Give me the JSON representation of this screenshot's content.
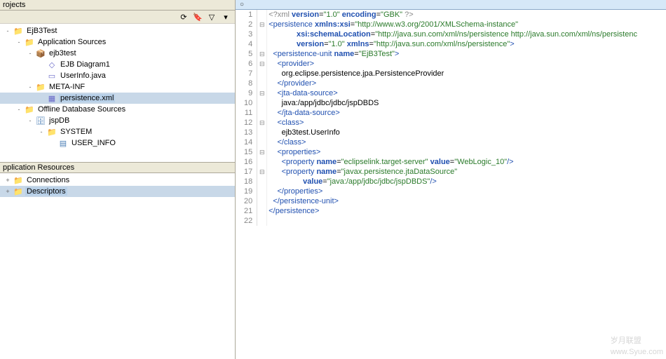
{
  "panels": {
    "projects_title": "rojects",
    "app_resources_title": "pplication Resources"
  },
  "toolbar_icons": [
    "refresh",
    "funnel",
    "layout",
    "menu"
  ],
  "tree": [
    {
      "d": 0,
      "tw": "-",
      "ico": "📁",
      "cls": "fold",
      "label": "EjB3Test",
      "int": true
    },
    {
      "d": 1,
      "tw": "-",
      "ico": "📁",
      "cls": "fold",
      "label": "Application Sources",
      "int": true
    },
    {
      "d": 2,
      "tw": "-",
      "ico": "📦",
      "cls": "pkg",
      "label": "ejb3test",
      "int": true
    },
    {
      "d": 3,
      "tw": " ",
      "ico": "◇",
      "cls": "file",
      "label": "EJB Diagram1",
      "int": true
    },
    {
      "d": 3,
      "tw": " ",
      "ico": "▭",
      "cls": "file",
      "label": "UserInfo.java",
      "int": true
    },
    {
      "d": 2,
      "tw": "-",
      "ico": "📁",
      "cls": "fold",
      "label": "META-INF",
      "int": true
    },
    {
      "d": 3,
      "tw": " ",
      "ico": "▦",
      "cls": "file",
      "label": "persistence.xml",
      "int": true,
      "sel": true
    },
    {
      "d": 1,
      "tw": "-",
      "ico": "📁",
      "cls": "fold",
      "label": "Offline Database Sources",
      "int": true
    },
    {
      "d": 2,
      "tw": "-",
      "ico": "🗄",
      "cls": "db",
      "label": "jspDB",
      "int": true
    },
    {
      "d": 3,
      "tw": "-",
      "ico": "📁",
      "cls": "fold",
      "label": "SYSTEM",
      "int": true
    },
    {
      "d": 4,
      "tw": " ",
      "ico": "▤",
      "cls": "db",
      "label": "USER_INFO",
      "int": true
    }
  ],
  "app_resources": [
    {
      "d": 0,
      "tw": "+",
      "ico": "📁",
      "cls": "fold",
      "label": "Connections",
      "int": true
    },
    {
      "d": 0,
      "tw": "+",
      "ico": "📁",
      "cls": "fold",
      "label": "Descriptors",
      "int": true,
      "sel": true
    }
  ],
  "editor_tab_marker": "○",
  "code_lines": [
    {
      "n": 1,
      "f": " ",
      "h": "<span class='t-gray'>&lt;?xml</span> <span class='t-attr'>version</span>=<span class='t-str'>\"1.0\"</span> <span class='t-attr'>encoding</span>=<span class='t-str'>\"GBK\"</span> <span class='t-gray'>?&gt;</span>"
    },
    {
      "n": 2,
      "f": "⊟",
      "h": "<span class='t-tag'>&lt;persistence</span> <span class='t-attr'>xmlns:xsi</span>=<span class='t-str'>\"http://www.w3.org/2001/XMLSchema-instance\"</span>"
    },
    {
      "n": 3,
      "f": " ",
      "h": "             <span class='t-attr'>xsi:schemaLocation</span>=<span class='t-str'>\"http://java.sun.com/xml/ns/persistence http://java.sun.com/xml/ns/persistenc</span>"
    },
    {
      "n": 4,
      "f": " ",
      "h": "             <span class='t-attr'>version</span>=<span class='t-str'>\"1.0\"</span> <span class='t-attr'>xmlns</span>=<span class='t-str'>\"http://java.sun.com/xml/ns/persistence\"</span><span class='t-tag'>&gt;</span>"
    },
    {
      "n": 5,
      "f": "⊟",
      "h": "  <span class='t-tag'>&lt;persistence-unit</span> <span class='t-attr'>name</span>=<span class='t-str'>\"EjB3Test\"</span><span class='t-tag'>&gt;</span>"
    },
    {
      "n": 6,
      "f": "⊟",
      "h": "    <span class='t-tag'>&lt;provider&gt;</span>"
    },
    {
      "n": 7,
      "f": " ",
      "h": "      org.eclipse.persistence.jpa.PersistenceProvider"
    },
    {
      "n": 8,
      "f": " ",
      "h": "    <span class='t-tag'>&lt;/provider&gt;</span>"
    },
    {
      "n": 9,
      "f": "⊟",
      "h": "    <span class='t-tag'>&lt;jta-data-source&gt;</span>"
    },
    {
      "n": 10,
      "f": " ",
      "h": "      java:/app/jdbc/jdbc/jspDBDS"
    },
    {
      "n": 11,
      "f": " ",
      "h": "    <span class='t-tag'>&lt;/jta-data-source&gt;</span>"
    },
    {
      "n": 12,
      "f": "⊟",
      "h": "    <span class='t-tag'>&lt;class&gt;</span>"
    },
    {
      "n": 13,
      "f": " ",
      "h": "      ejb3test.UserInfo"
    },
    {
      "n": 14,
      "f": " ",
      "h": "    <span class='t-tag'>&lt;/class&gt;</span>"
    },
    {
      "n": 15,
      "f": "⊟",
      "h": "    <span class='t-tag'>&lt;properties&gt;</span>"
    },
    {
      "n": 16,
      "f": " ",
      "h": "      <span class='t-tag'>&lt;property</span> <span class='t-attr'>name</span>=<span class='t-str'>\"eclipselink.target-server\"</span> <span class='t-attr'>value</span>=<span class='t-str'>\"WebLogic_10\"</span><span class='t-tag'>/&gt;</span>"
    },
    {
      "n": 17,
      "f": "⊟",
      "h": "      <span class='t-tag'>&lt;property</span> <span class='t-attr'>name</span>=<span class='t-str'>\"javax.persistence.jtaDataSource\"</span>"
    },
    {
      "n": 18,
      "f": " ",
      "h": "                <span class='t-attr'>value</span>=<span class='t-str'>\"java:/app/jdbc/jdbc/jspDBDS\"</span><span class='t-tag'>/&gt;</span>"
    },
    {
      "n": 19,
      "f": " ",
      "h": "    <span class='t-tag'>&lt;/properties&gt;</span>"
    },
    {
      "n": 20,
      "f": " ",
      "h": "  <span class='t-tag'>&lt;/persistence-unit&gt;</span>"
    },
    {
      "n": 21,
      "f": " ",
      "h": "<span class='t-tag'>&lt;/persistence&gt;</span>"
    },
    {
      "n": 22,
      "f": " ",
      "h": ""
    }
  ],
  "watermark": {
    "big": "岁月联盟",
    "small": "www.Syue.com"
  }
}
